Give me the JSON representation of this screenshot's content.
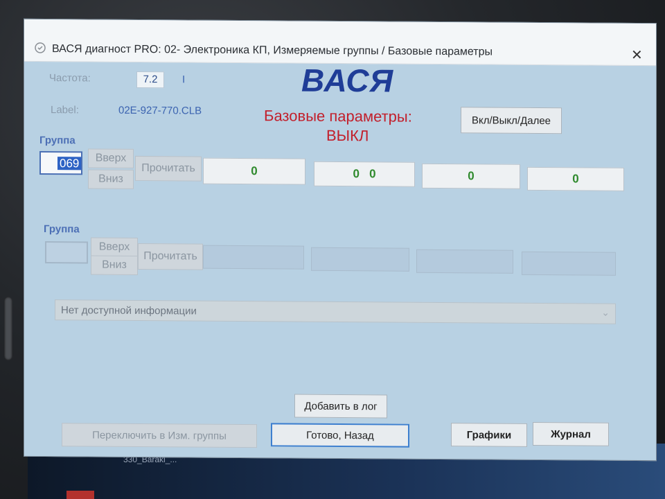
{
  "window": {
    "title": "ВАСЯ диагност PRO: 02- Электроника КП,  Измеряемые группы / Базовые параметры",
    "close_glyph": "✕"
  },
  "header": {
    "frequency_label": "Частота:",
    "frequency_value": "7.2",
    "frequency_unit": "I",
    "label_label": "Label:",
    "label_value": "02E-927-770.CLB",
    "brand": "ВАСЯ",
    "basic_params_title": "Базовые параметры:",
    "basic_params_state": "ВЫКЛ",
    "toggle_button": "Вкл/Выкл/Далее"
  },
  "group1": {
    "label": "Группа",
    "value": "069",
    "up": "Вверх",
    "down": "Вниз",
    "read": "Прочитать",
    "fields": [
      "0",
      "0   0",
      "0",
      "0"
    ]
  },
  "group2": {
    "label": "Группа",
    "value": "",
    "up": "Вверх",
    "down": "Вниз",
    "read": "Прочитать"
  },
  "info": {
    "text": "Нет доступной информации"
  },
  "buttons": {
    "add_log": "Добавить в лог",
    "switch_groups": "Переключить в Изм. группы",
    "done_back": "Готово, Назад",
    "graphs": "Графики",
    "journal": "Журнал"
  },
  "taskbar": {
    "label": "330_Baraki_..."
  },
  "colors": {
    "window_bg": "#b8d1e3",
    "brand": "#1f3d97",
    "basic_params": "#c21f2b",
    "value_green": "#2f8a2d"
  }
}
